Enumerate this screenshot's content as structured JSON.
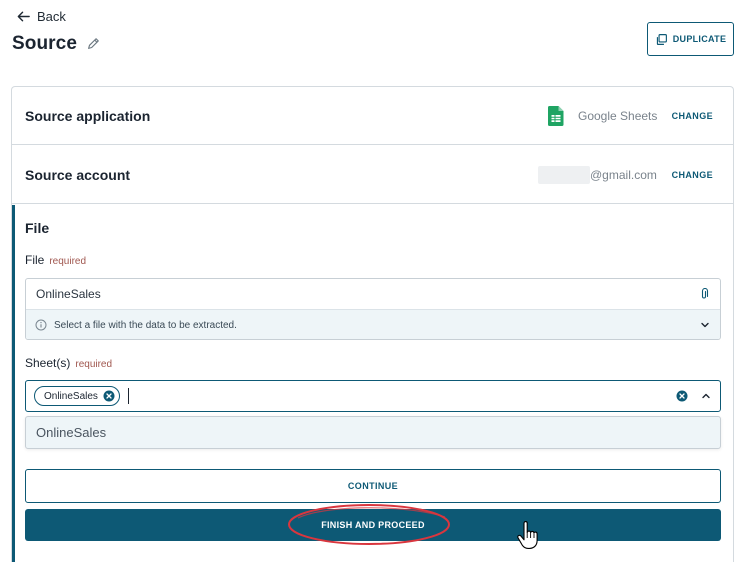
{
  "header": {
    "back_label": "Back",
    "title": "Source",
    "duplicate_label": "DUPLICATE"
  },
  "source_application": {
    "label": "Source application",
    "value": "Google Sheets",
    "icon": "google-sheets-icon",
    "change_label": "CHANGE"
  },
  "source_account": {
    "label": "Source account",
    "value": "@gmail.com",
    "change_label": "CHANGE"
  },
  "file_section": {
    "title": "File",
    "file_field": {
      "label": "File",
      "required_label": "required",
      "value": "OnlineSales",
      "hint": "Select a file with the data to be extracted."
    },
    "sheets_field": {
      "label": "Sheet(s)",
      "required_label": "required",
      "selected": [
        "OnlineSales"
      ],
      "options": [
        "OnlineSales"
      ]
    },
    "continue_label": "CONTINUE",
    "finish_label": "FINISH AND PROCEED"
  },
  "colors": {
    "accent": "#0d5975",
    "annotation": "#d9363e",
    "sheets_green": "#1fa463"
  }
}
